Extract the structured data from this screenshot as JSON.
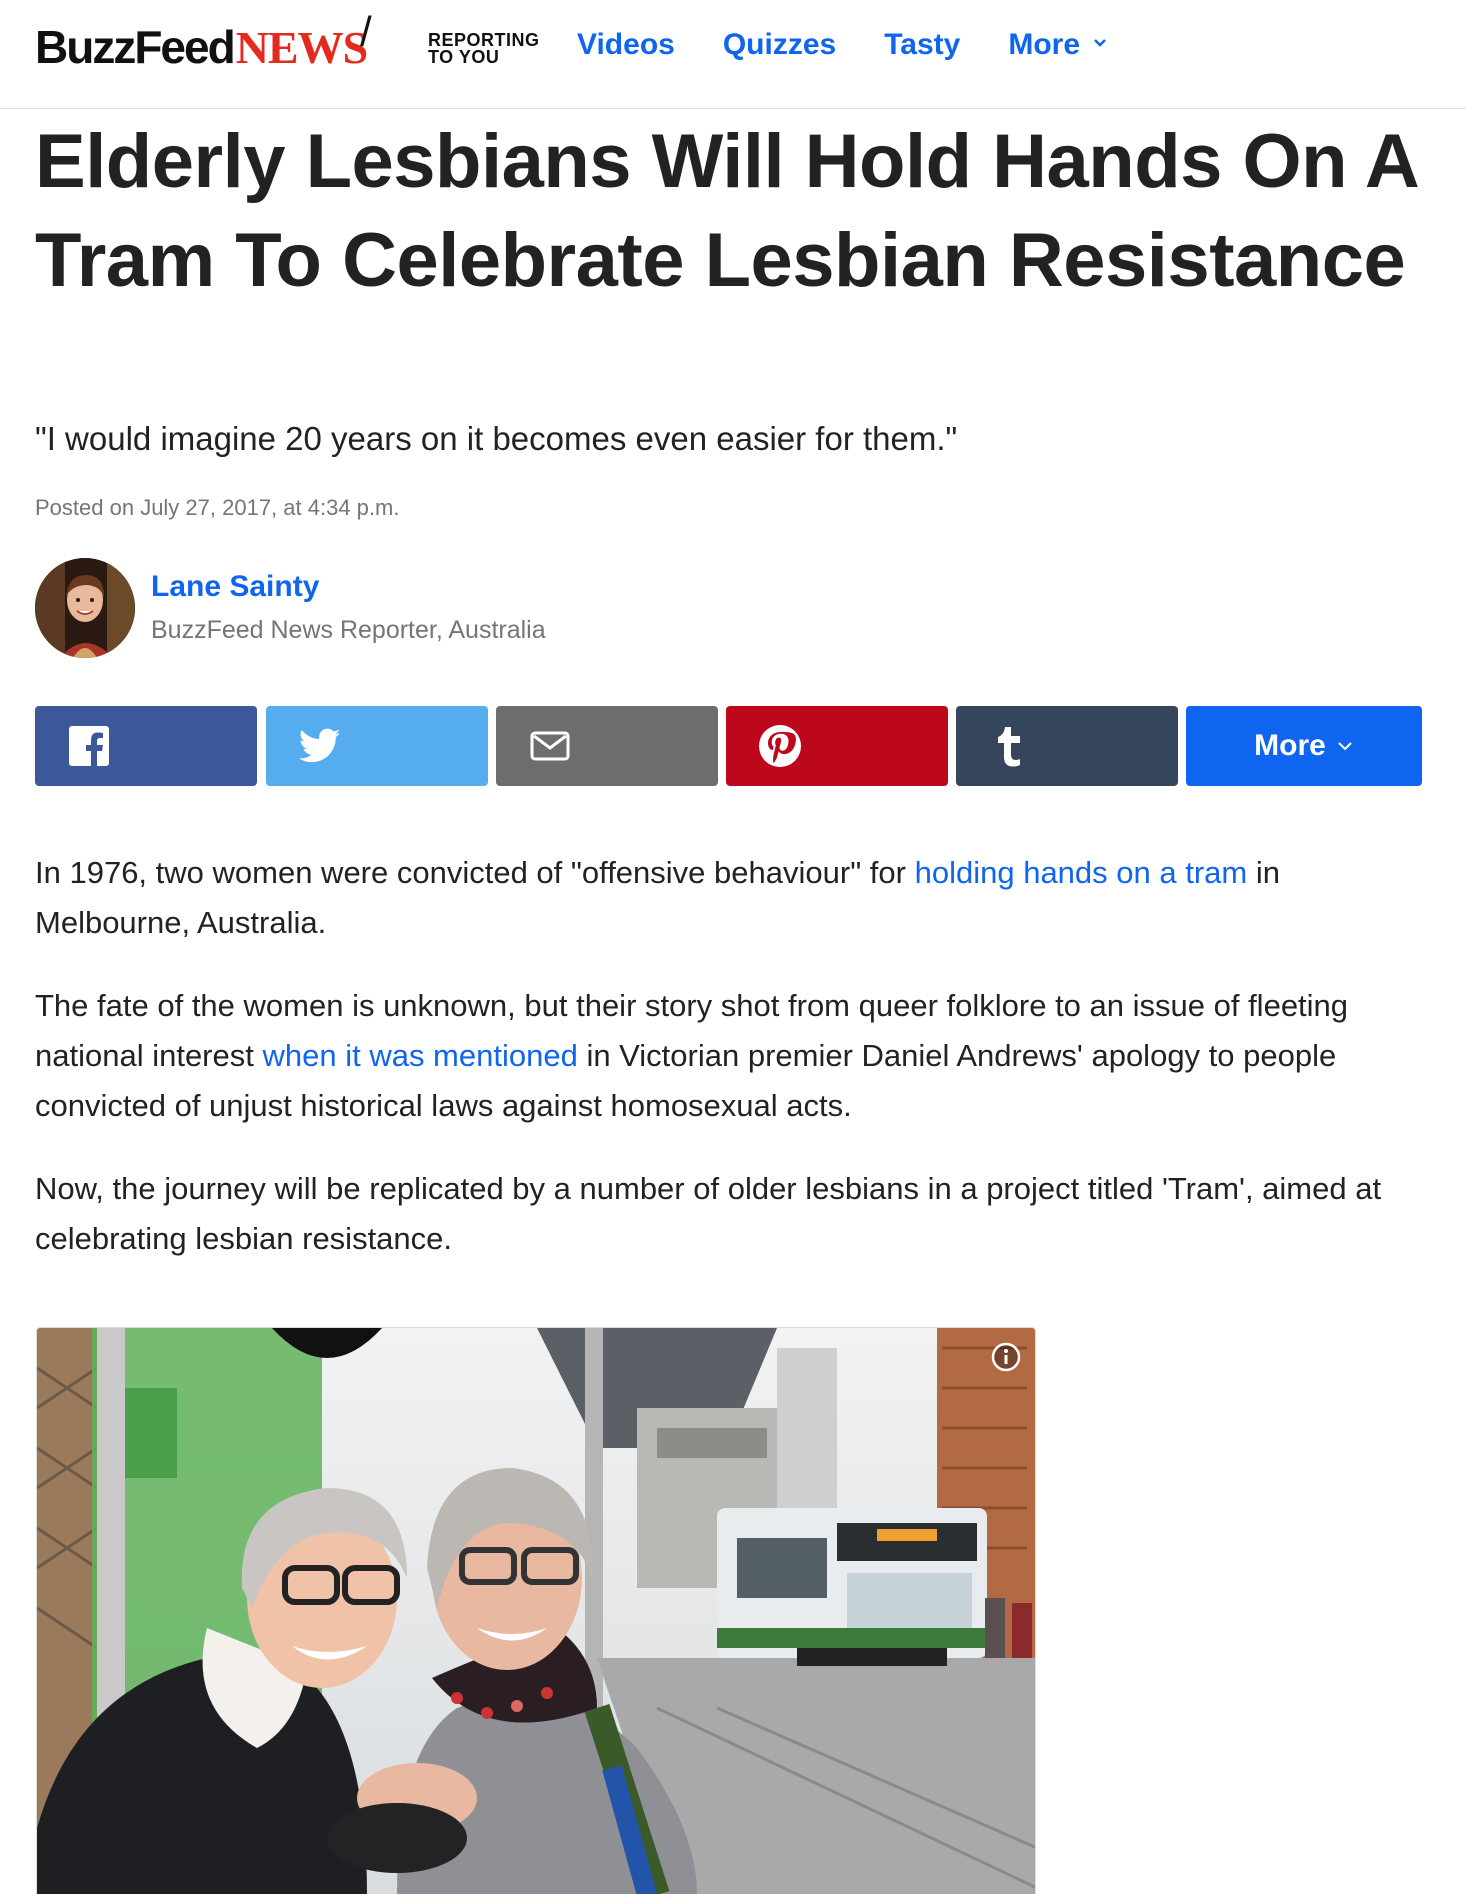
{
  "header": {
    "logo_buzz": "BuzzFeed",
    "logo_news": "NEWS",
    "slash": "/",
    "tagline_line1": "REPORTING",
    "tagline_line2": "TO YOU",
    "nav": [
      {
        "label": "Videos"
      },
      {
        "label": "Quizzes"
      },
      {
        "label": "Tasty"
      },
      {
        "label": "More"
      }
    ]
  },
  "article": {
    "headline": "Elderly Lesbians Will Hold Hands On A Tram To Celebrate Lesbian Resistance",
    "dek": "\"I would imagine 20 years on it becomes even easier for them.\"",
    "posted": "Posted on July 27, 2017, at 4:34 p.m.",
    "author": {
      "name": "Lane Sainty",
      "title": "BuzzFeed News Reporter, Australia"
    },
    "share": {
      "more_label": "More"
    },
    "paragraphs": {
      "p1_a": "In 1976, two women were convicted of \"offensive behaviour\" for ",
      "p1_link": "holding hands on a tram",
      "p1_b": " in Melbourne, Australia.",
      "p2_a": "The fate of the women is unknown, but their story shot from queer folklore to an issue of fleeting national interest ",
      "p2_link": "when it was mentioned",
      "p2_b": " in Victorian premier Daniel Andrews' apology to people convicted of unjust historical laws against homosexual acts.",
      "p3": "Now, the journey will be replicated by a number of older lesbians in a project titled 'Tram', aimed at celebrating lesbian resistance."
    }
  },
  "icons": {
    "facebook": "facebook-icon",
    "twitter": "twitter-icon",
    "email": "email-icon",
    "pinterest": "pinterest-icon",
    "tumblr": "tumblr-icon",
    "info": "info-icon"
  },
  "colors": {
    "link_blue": "#0f65ef",
    "news_red": "#e32a1d",
    "facebook": "#3b5998",
    "twitter": "#55acee",
    "email": "#6d6d6d",
    "pinterest": "#bd081c",
    "tumblr": "#35465c"
  }
}
